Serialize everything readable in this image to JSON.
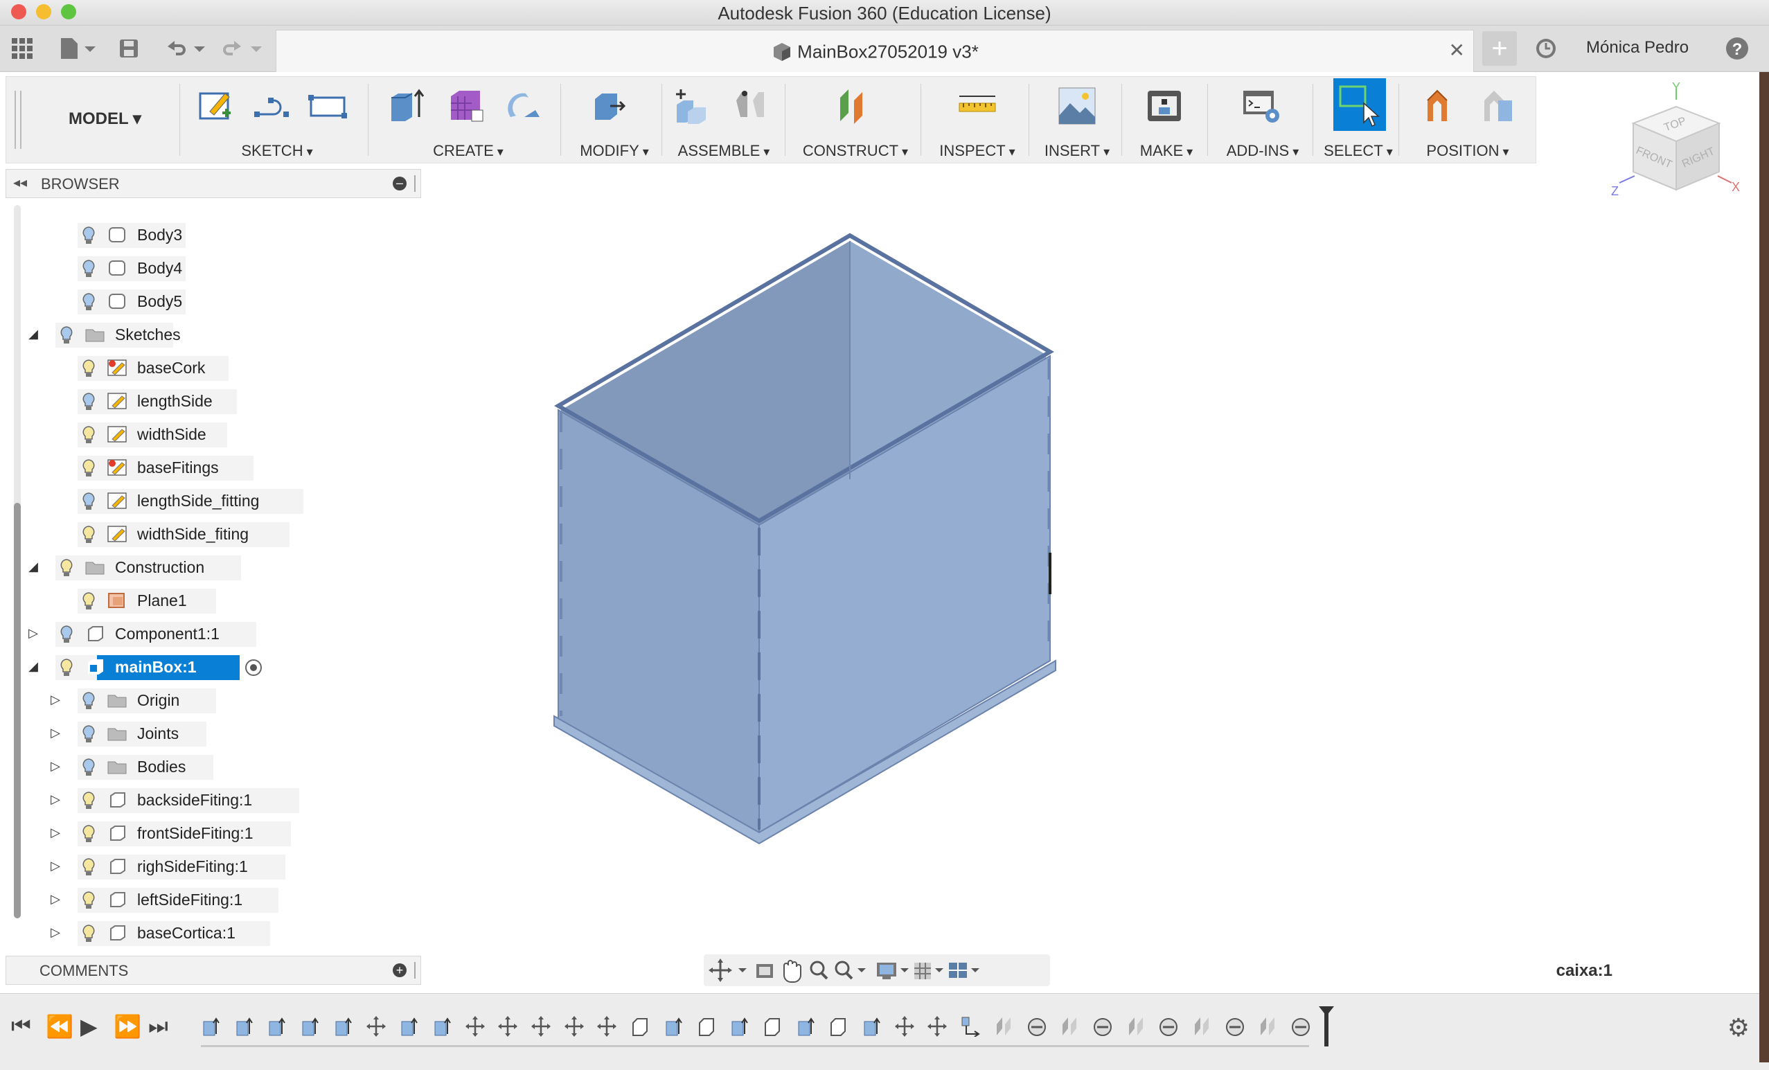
{
  "window": {
    "title": "Autodesk Fusion 360 (Education License)"
  },
  "tabbar": {
    "document_title": "MainBox27052019 v3*",
    "user_name": "Mónica Pedro"
  },
  "toolbar": {
    "workspace": "MODEL",
    "groups": [
      "SKETCH",
      "CREATE",
      "MODIFY",
      "ASSEMBLE",
      "CONSTRUCT",
      "INSPECT",
      "INSERT",
      "MAKE",
      "ADD-INS",
      "SELECT",
      "POSITION"
    ]
  },
  "viewcube": {
    "top": "TOP",
    "front": "FRONT",
    "right": "RIGHT",
    "axis_x": "X",
    "axis_y": "Y",
    "axis_z": "Z"
  },
  "browser": {
    "title": "BROWSER",
    "rows": [
      {
        "label": "Body3",
        "icon": "body-icon"
      },
      {
        "label": "Body4",
        "icon": "body-icon"
      },
      {
        "label": "Body5",
        "icon": "body-icon"
      },
      {
        "label": "Sketches",
        "icon": "folder-icon"
      },
      {
        "label": "baseCork",
        "icon": "sketch-warning-icon"
      },
      {
        "label": "lengthSide",
        "icon": "sketch-icon"
      },
      {
        "label": "widthSide",
        "icon": "sketch-icon"
      },
      {
        "label": "baseFitings",
        "icon": "sketch-warning-icon"
      },
      {
        "label": "lengthSide_fitting",
        "icon": "sketch-icon"
      },
      {
        "label": "widthSide_fiting",
        "icon": "sketch-icon"
      },
      {
        "label": "Construction",
        "icon": "folder-icon"
      },
      {
        "label": "Plane1",
        "icon": "plane-icon"
      },
      {
        "label": "Component1:1",
        "icon": "component-icon"
      },
      {
        "label": "mainBox:1",
        "icon": "component-active-icon"
      },
      {
        "label": "Origin",
        "icon": "folder-icon"
      },
      {
        "label": "Joints",
        "icon": "folder-icon"
      },
      {
        "label": "Bodies",
        "icon": "folder-icon"
      },
      {
        "label": "backsideFiting:1",
        "icon": "component-icon"
      },
      {
        "label": "frontSideFiting:1",
        "icon": "component-icon"
      },
      {
        "label": "righSideFiting:1",
        "icon": "component-icon"
      },
      {
        "label": "leftSideFiting:1",
        "icon": "component-icon"
      },
      {
        "label": "baseCortica:1",
        "icon": "component-icon"
      }
    ]
  },
  "comments": {
    "title": "COMMENTS"
  },
  "status": {
    "active_component": "caixa:1"
  },
  "colors": {
    "selection": "#0a7fd6",
    "model_fill": "#8ea8cc",
    "ribbon_bg": "#f0f0f0"
  }
}
